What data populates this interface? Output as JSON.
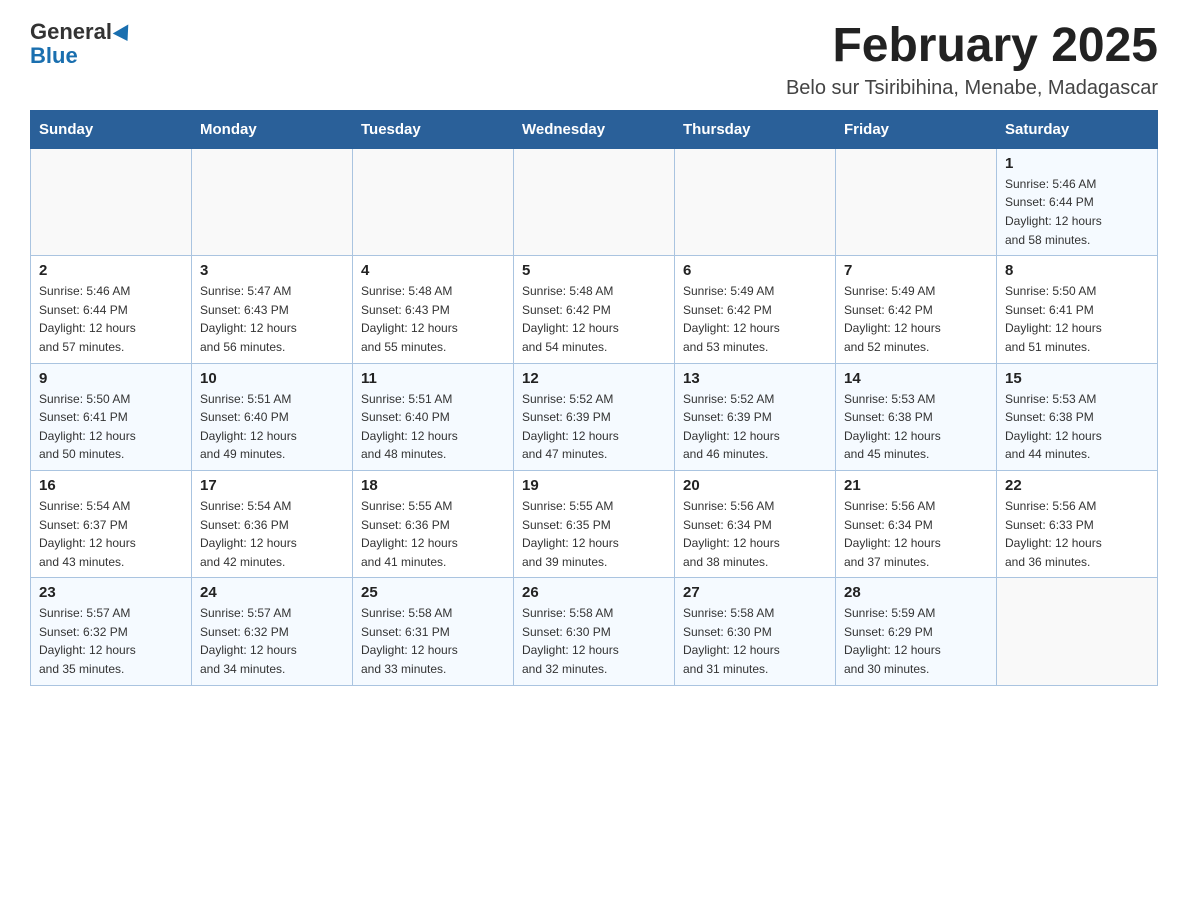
{
  "header": {
    "logo_general": "General",
    "logo_blue": "Blue",
    "month_title": "February 2025",
    "location": "Belo sur Tsiribihina, Menabe, Madagascar"
  },
  "weekdays": [
    "Sunday",
    "Monday",
    "Tuesday",
    "Wednesday",
    "Thursday",
    "Friday",
    "Saturday"
  ],
  "weeks": [
    [
      {
        "day": "",
        "info": ""
      },
      {
        "day": "",
        "info": ""
      },
      {
        "day": "",
        "info": ""
      },
      {
        "day": "",
        "info": ""
      },
      {
        "day": "",
        "info": ""
      },
      {
        "day": "",
        "info": ""
      },
      {
        "day": "1",
        "info": "Sunrise: 5:46 AM\nSunset: 6:44 PM\nDaylight: 12 hours\nand 58 minutes."
      }
    ],
    [
      {
        "day": "2",
        "info": "Sunrise: 5:46 AM\nSunset: 6:44 PM\nDaylight: 12 hours\nand 57 minutes."
      },
      {
        "day": "3",
        "info": "Sunrise: 5:47 AM\nSunset: 6:43 PM\nDaylight: 12 hours\nand 56 minutes."
      },
      {
        "day": "4",
        "info": "Sunrise: 5:48 AM\nSunset: 6:43 PM\nDaylight: 12 hours\nand 55 minutes."
      },
      {
        "day": "5",
        "info": "Sunrise: 5:48 AM\nSunset: 6:42 PM\nDaylight: 12 hours\nand 54 minutes."
      },
      {
        "day": "6",
        "info": "Sunrise: 5:49 AM\nSunset: 6:42 PM\nDaylight: 12 hours\nand 53 minutes."
      },
      {
        "day": "7",
        "info": "Sunrise: 5:49 AM\nSunset: 6:42 PM\nDaylight: 12 hours\nand 52 minutes."
      },
      {
        "day": "8",
        "info": "Sunrise: 5:50 AM\nSunset: 6:41 PM\nDaylight: 12 hours\nand 51 minutes."
      }
    ],
    [
      {
        "day": "9",
        "info": "Sunrise: 5:50 AM\nSunset: 6:41 PM\nDaylight: 12 hours\nand 50 minutes."
      },
      {
        "day": "10",
        "info": "Sunrise: 5:51 AM\nSunset: 6:40 PM\nDaylight: 12 hours\nand 49 minutes."
      },
      {
        "day": "11",
        "info": "Sunrise: 5:51 AM\nSunset: 6:40 PM\nDaylight: 12 hours\nand 48 minutes."
      },
      {
        "day": "12",
        "info": "Sunrise: 5:52 AM\nSunset: 6:39 PM\nDaylight: 12 hours\nand 47 minutes."
      },
      {
        "day": "13",
        "info": "Sunrise: 5:52 AM\nSunset: 6:39 PM\nDaylight: 12 hours\nand 46 minutes."
      },
      {
        "day": "14",
        "info": "Sunrise: 5:53 AM\nSunset: 6:38 PM\nDaylight: 12 hours\nand 45 minutes."
      },
      {
        "day": "15",
        "info": "Sunrise: 5:53 AM\nSunset: 6:38 PM\nDaylight: 12 hours\nand 44 minutes."
      }
    ],
    [
      {
        "day": "16",
        "info": "Sunrise: 5:54 AM\nSunset: 6:37 PM\nDaylight: 12 hours\nand 43 minutes."
      },
      {
        "day": "17",
        "info": "Sunrise: 5:54 AM\nSunset: 6:36 PM\nDaylight: 12 hours\nand 42 minutes."
      },
      {
        "day": "18",
        "info": "Sunrise: 5:55 AM\nSunset: 6:36 PM\nDaylight: 12 hours\nand 41 minutes."
      },
      {
        "day": "19",
        "info": "Sunrise: 5:55 AM\nSunset: 6:35 PM\nDaylight: 12 hours\nand 39 minutes."
      },
      {
        "day": "20",
        "info": "Sunrise: 5:56 AM\nSunset: 6:34 PM\nDaylight: 12 hours\nand 38 minutes."
      },
      {
        "day": "21",
        "info": "Sunrise: 5:56 AM\nSunset: 6:34 PM\nDaylight: 12 hours\nand 37 minutes."
      },
      {
        "day": "22",
        "info": "Sunrise: 5:56 AM\nSunset: 6:33 PM\nDaylight: 12 hours\nand 36 minutes."
      }
    ],
    [
      {
        "day": "23",
        "info": "Sunrise: 5:57 AM\nSunset: 6:32 PM\nDaylight: 12 hours\nand 35 minutes."
      },
      {
        "day": "24",
        "info": "Sunrise: 5:57 AM\nSunset: 6:32 PM\nDaylight: 12 hours\nand 34 minutes."
      },
      {
        "day": "25",
        "info": "Sunrise: 5:58 AM\nSunset: 6:31 PM\nDaylight: 12 hours\nand 33 minutes."
      },
      {
        "day": "26",
        "info": "Sunrise: 5:58 AM\nSunset: 6:30 PM\nDaylight: 12 hours\nand 32 minutes."
      },
      {
        "day": "27",
        "info": "Sunrise: 5:58 AM\nSunset: 6:30 PM\nDaylight: 12 hours\nand 31 minutes."
      },
      {
        "day": "28",
        "info": "Sunrise: 5:59 AM\nSunset: 6:29 PM\nDaylight: 12 hours\nand 30 minutes."
      },
      {
        "day": "",
        "info": ""
      }
    ]
  ]
}
